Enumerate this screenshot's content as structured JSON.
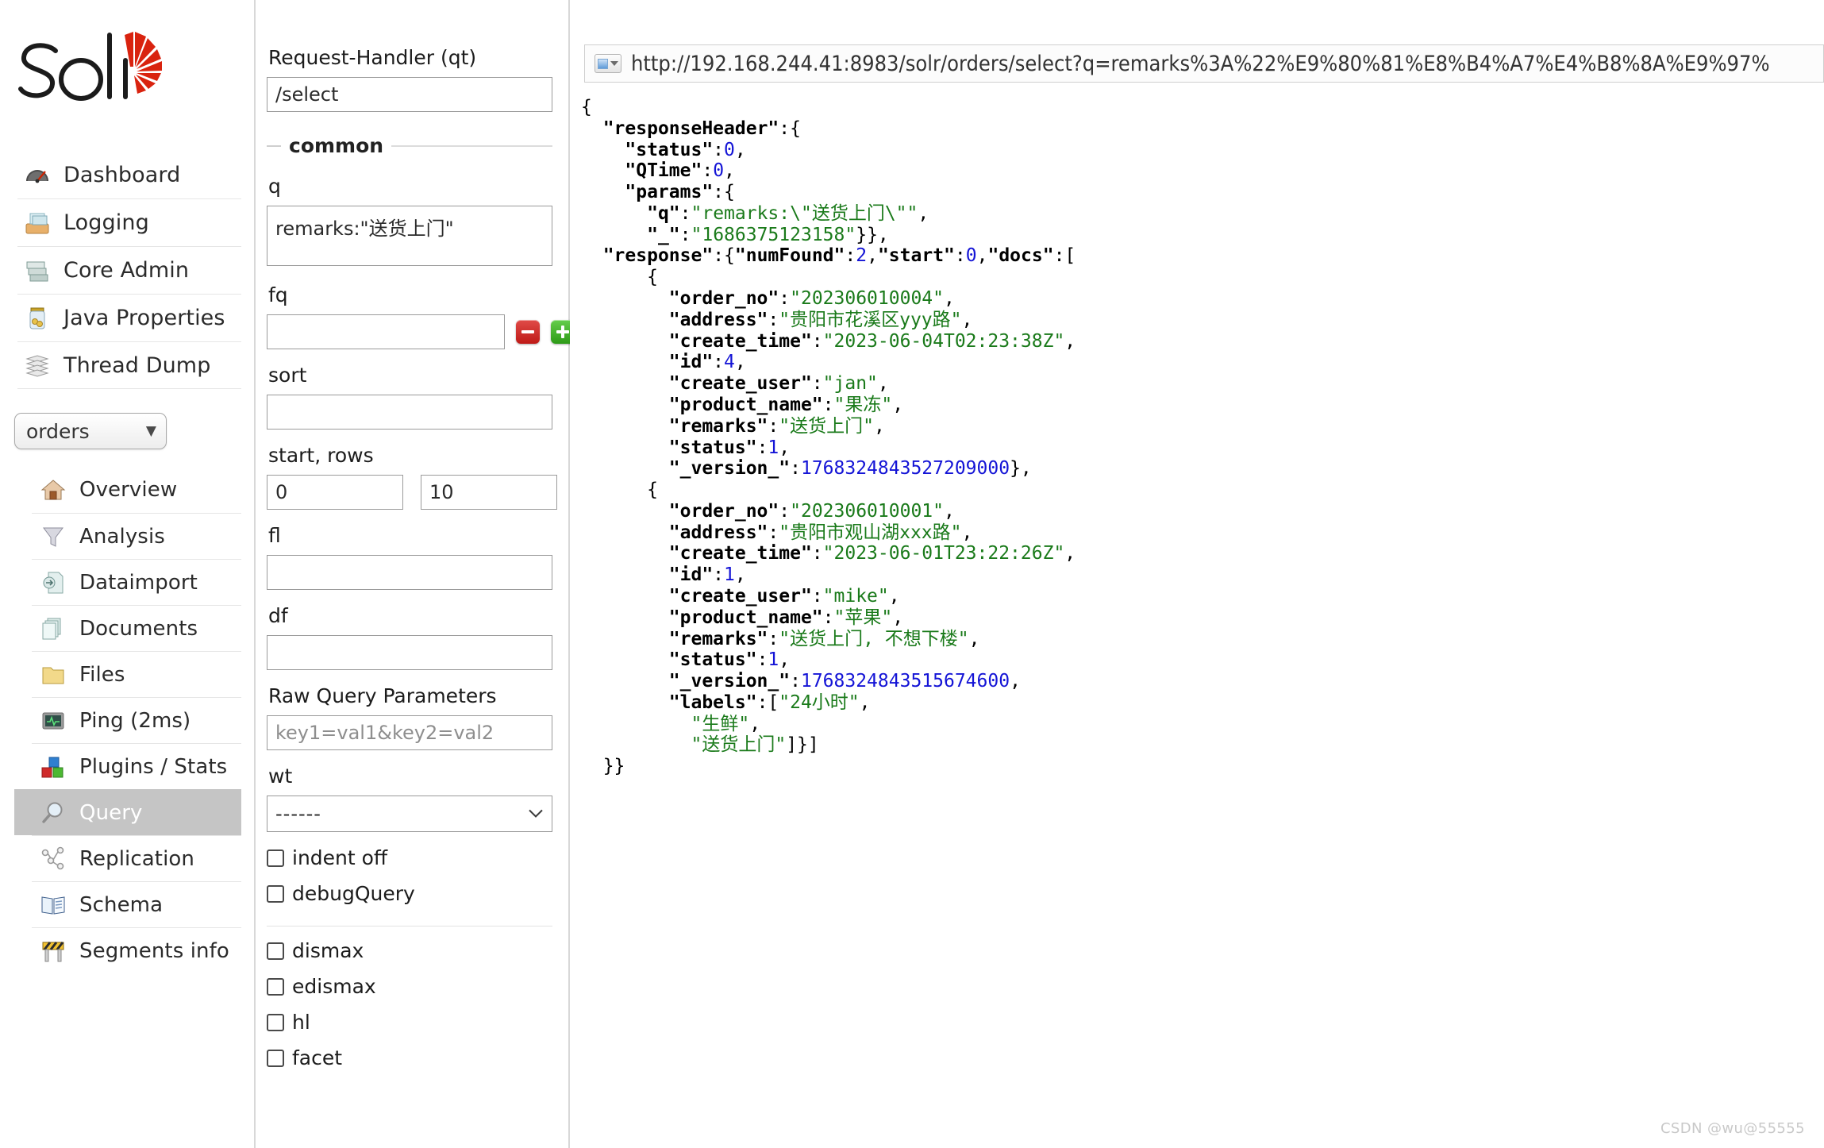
{
  "brand": {
    "name": "Solr",
    "logo_red": "#d9230f"
  },
  "sidebar": {
    "top_items": [
      {
        "label": "Dashboard",
        "icon": "dashboard-gauge-icon"
      },
      {
        "label": "Logging",
        "icon": "logging-tray-icon"
      },
      {
        "label": "Core Admin",
        "icon": "core-admin-server-icon"
      },
      {
        "label": "Java Properties",
        "icon": "java-properties-jar-icon"
      },
      {
        "label": "Thread Dump",
        "icon": "thread-dump-stack-icon"
      }
    ],
    "core_selector": {
      "value": "orders",
      "caret": "▼"
    },
    "core_items": [
      {
        "label": "Overview",
        "icon": "home-icon",
        "active": false
      },
      {
        "label": "Analysis",
        "icon": "funnel-icon",
        "active": false
      },
      {
        "label": "Dataimport",
        "icon": "dataimport-icon",
        "active": false
      },
      {
        "label": "Documents",
        "icon": "documents-icon",
        "active": false
      },
      {
        "label": "Files",
        "icon": "folder-icon",
        "active": false
      },
      {
        "label": "Ping (2ms)",
        "icon": "ping-monitor-icon",
        "active": false
      },
      {
        "label": "Plugins / Stats",
        "icon": "plugins-blocks-icon",
        "active": false
      },
      {
        "label": "Query",
        "icon": "magnifier-icon",
        "active": true
      },
      {
        "label": "Replication",
        "icon": "replication-nodes-icon",
        "active": false
      },
      {
        "label": "Schema",
        "icon": "schema-book-icon",
        "active": false
      },
      {
        "label": "Segments info",
        "icon": "segments-barrier-icon",
        "active": false
      }
    ]
  },
  "form": {
    "request_handler": {
      "label": "Request-Handler (qt)",
      "value": "/select"
    },
    "common_legend": "common",
    "q": {
      "label": "q",
      "value": "remarks:\"送货上门\""
    },
    "fq": {
      "label": "fq",
      "value": "",
      "remove_button": "−",
      "add_button": "+"
    },
    "sort": {
      "label": "sort",
      "value": ""
    },
    "start_rows": {
      "label": "start, rows",
      "start": "0",
      "rows": "10"
    },
    "fl": {
      "label": "fl",
      "value": ""
    },
    "df": {
      "label": "df",
      "value": ""
    },
    "raw_query_parameters": {
      "label": "Raw Query Parameters",
      "placeholder": "key1=val1&key2=val2",
      "value": ""
    },
    "wt": {
      "label": "wt",
      "value": "------"
    },
    "checkboxes": [
      {
        "label": "indent off",
        "checked": false
      },
      {
        "label": "debugQuery",
        "checked": false
      }
    ],
    "parser_checkboxes": [
      {
        "label": "dismax",
        "checked": false
      },
      {
        "label": "edismax",
        "checked": false,
        "bold_prefix": "e"
      },
      {
        "label": "hl",
        "checked": false
      },
      {
        "label": "facet",
        "checked": false
      }
    ]
  },
  "result": {
    "url": "http://192.168.244.41:8983/solr/orders/select?q=remarks%3A%22%E9%80%81%E8%B4%A7%E4%B8%8A%E9%97%",
    "url_icon": "window-dropdown-icon",
    "response": {
      "responseHeader": {
        "status": 0,
        "QTime": 0,
        "params": {
          "q": "remarks:\\\"送货上门\\\"",
          "_": "1686375123158"
        }
      },
      "response": {
        "numFound": 2,
        "start": 0,
        "docs": [
          {
            "order_no": "202306010004",
            "address": "贵阳市花溪区yyy路",
            "create_time": "2023-06-04T02:23:38Z",
            "id": 4,
            "create_user": "jan",
            "product_name": "果冻",
            "remarks": "送货上门",
            "status": 1,
            "_version_": 1768324843527208960
          },
          {
            "order_no": "202306010001",
            "address": "贵阳市观山湖xxx路",
            "create_time": "2023-06-01T23:22:26Z",
            "id": 1,
            "create_user": "mike",
            "product_name": "苹果",
            "remarks": "送货上门, 不想下楼",
            "status": 1,
            "_version_": 1768324843515674624,
            "labels": [
              "24小时",
              "生鲜",
              "送货上门"
            ]
          }
        ]
      }
    }
  },
  "watermark": "CSDN @wu@55555"
}
